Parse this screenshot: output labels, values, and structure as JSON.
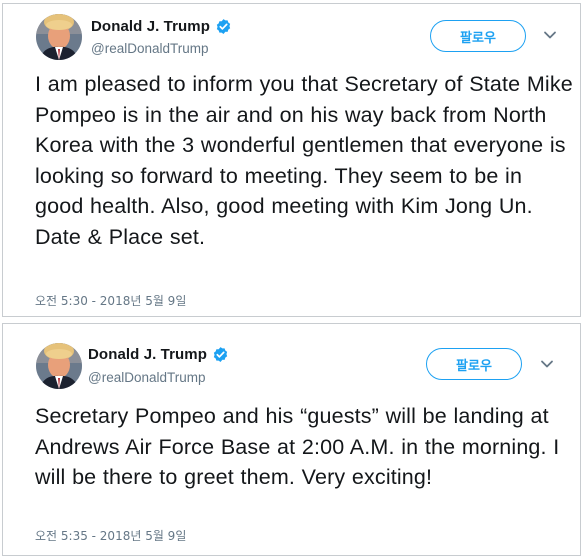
{
  "tweets": [
    {
      "author": {
        "name": "Donald J. Trump",
        "handle": "@realDonaldTrump",
        "verified": true
      },
      "follow_label": "팔로우",
      "text": "I am pleased to inform you that Secretary of State Mike Pompeo is in the air and on his way back from North Korea with the 3 wonderful gentlemen that everyone is looking so forward to meeting. They seem to be in good health. Also, good meeting with Kim Jong Un. Date & Place set.",
      "timestamp": "오전 5:30 - 2018년 5월 9일"
    },
    {
      "author": {
        "name": "Donald J. Trump",
        "handle": "@realDonaldTrump",
        "verified": true
      },
      "follow_label": "팔로우",
      "text": "Secretary Pompeo and his “guests” will be landing at Andrews Air Force Base at 2:00 A.M. in the morning. I will be there to greet them. Very exciting!",
      "timestamp": "오전 5:35 - 2018년 5월 9일"
    }
  ],
  "colors": {
    "accent": "#1da1f2",
    "text_primary": "#14171a",
    "text_secondary": "#657786",
    "border": "#c8ccd0"
  },
  "icons": {
    "verified": "verified-badge-icon",
    "caret": "chevron-down-icon",
    "avatar": "profile-avatar"
  }
}
